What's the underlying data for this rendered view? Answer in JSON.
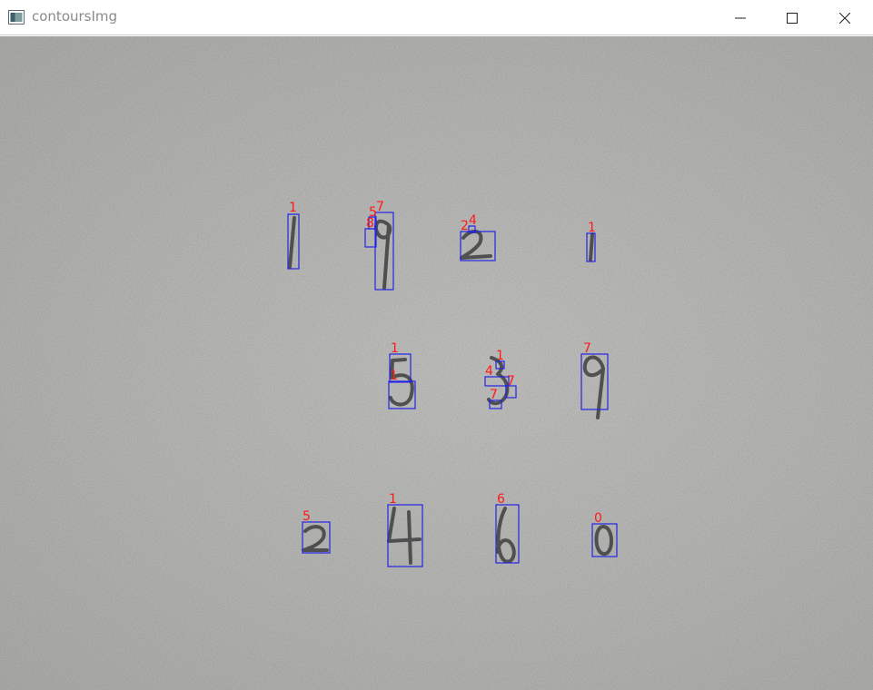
{
  "window": {
    "title": "contoursImg",
    "icon": "app-window-icon",
    "controls": {
      "minimize_icon": "minimize-icon",
      "maximize_icon": "maximize-icon",
      "close_icon": "close-icon"
    }
  },
  "colors": {
    "box_stroke": "#2020e0",
    "label": "#ff1a1a",
    "ink": "#3a3a3a"
  },
  "detections": [
    {
      "label": "1"
    },
    {
      "label": "7"
    },
    {
      "label": "5"
    },
    {
      "label": "8"
    },
    {
      "label": "4"
    },
    {
      "label": "2"
    },
    {
      "label": "1"
    },
    {
      "label": "1"
    },
    {
      "label": "1"
    },
    {
      "label": "1"
    },
    {
      "label": "4"
    },
    {
      "label": "7"
    },
    {
      "label": "7"
    },
    {
      "label": "7"
    },
    {
      "label": "5"
    },
    {
      "label": "1"
    },
    {
      "label": "6"
    },
    {
      "label": "0"
    }
  ]
}
